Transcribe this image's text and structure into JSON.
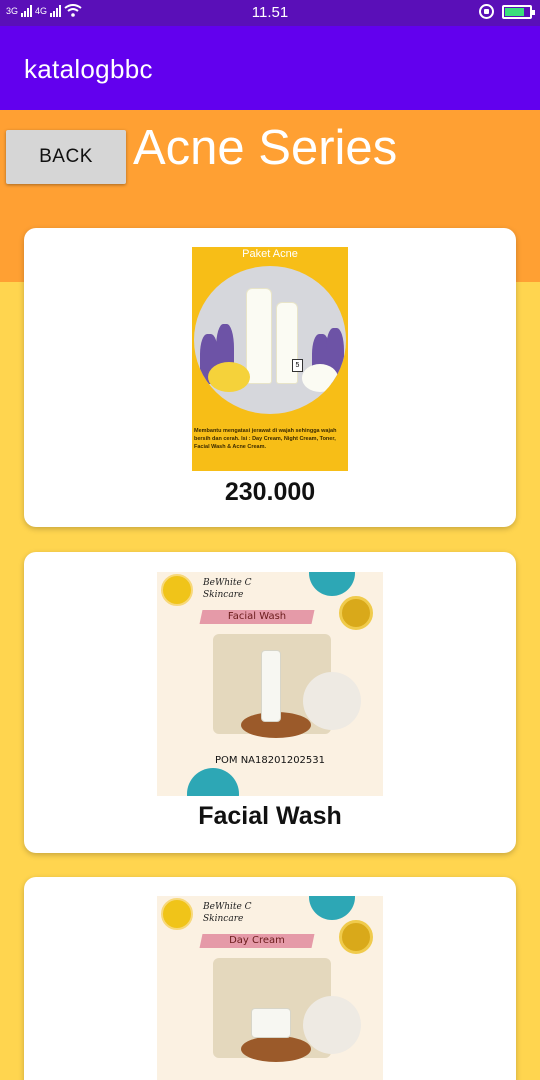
{
  "status_bar": {
    "network_1": "3G",
    "network_2": "4G",
    "time": "11.51",
    "battery_level": 0.8
  },
  "app_bar": {
    "title": "katalogbbc"
  },
  "header": {
    "back_label": "BACK",
    "page_title": "Acne Series"
  },
  "products": [
    {
      "image_caption": "Paket Acne",
      "image_badge": "5",
      "image_description": "Membantu mengatasi jerawat di wajah sehingga wajah bersih dan cerah. Isi : Day Cream, Night Cream, Toner, Facial Wash & Acne Cream.",
      "label": "230.000"
    },
    {
      "brand": "BeWhite C Skincare",
      "image_banner": "Facial Wash",
      "image_pom": "POM NA18201202531",
      "label": "Facial Wash"
    },
    {
      "brand": "BeWhite C Skincare",
      "image_banner": "Day Cream",
      "label": ""
    }
  ],
  "colors": {
    "status_bar": "#5A0FB8",
    "app_bar": "#6200EE",
    "header_band": "#FFA033",
    "background": "#FFD54F",
    "card": "#FFFFFF"
  }
}
